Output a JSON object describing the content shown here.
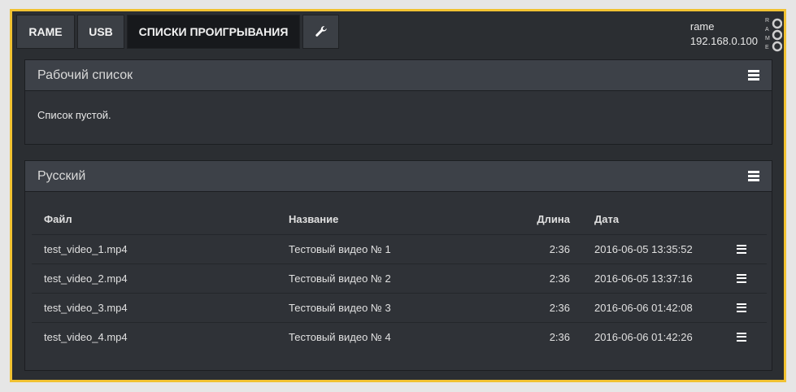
{
  "nav": {
    "tabs": [
      {
        "label": "RAME"
      },
      {
        "label": "USB"
      },
      {
        "label": "СПИСКИ ПРОИГРЫВАНИЯ"
      }
    ],
    "settings_icon": "wrench-icon",
    "active_tab": "СПИСКИ ПРОИГРЫВАНИЯ"
  },
  "device": {
    "name": "rame",
    "ip": "192.168.0.100",
    "logo_text": "RAME"
  },
  "work_list": {
    "title": "Рабочий список",
    "empty_text": "Список пустой."
  },
  "russian_list": {
    "title": "Русский",
    "columns": {
      "file": "Файл",
      "name": "Название",
      "length": "Длина",
      "date": "Дата"
    },
    "rows": [
      {
        "file": "test_video_1.mp4",
        "name": "Тестовый видео № 1",
        "length": "2:36",
        "date": "2016-06-05 13:35:52"
      },
      {
        "file": "test_video_2.mp4",
        "name": "Тестовый видео № 2",
        "length": "2:36",
        "date": "2016-06-05 13:37:16"
      },
      {
        "file": "test_video_3.mp4",
        "name": "Тестовый видео № 3",
        "length": "2:36",
        "date": "2016-06-06 01:42:08"
      },
      {
        "file": "test_video_4.mp4",
        "name": "Тестовый видео № 4",
        "length": "2:36",
        "date": "2016-06-06 01:42:26"
      }
    ]
  },
  "colors": {
    "frame_border": "#f1c232",
    "background": "#2b2e32",
    "panel_header": "#3d4148",
    "active_tab": "#17191c"
  }
}
